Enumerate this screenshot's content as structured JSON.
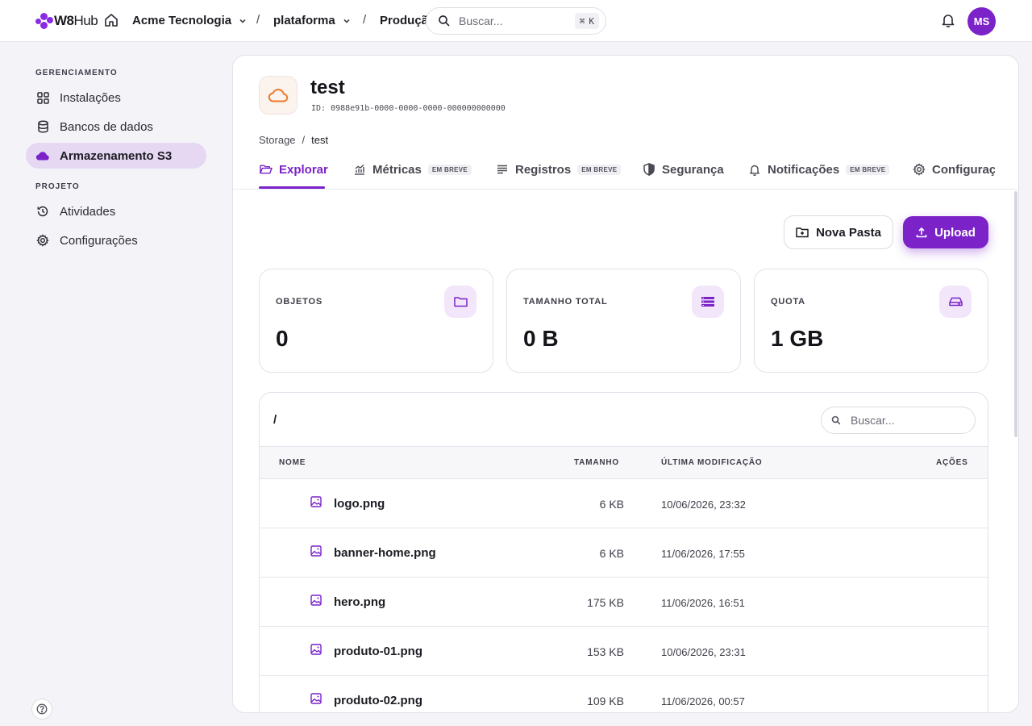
{
  "brand": {
    "name_bold": "W8",
    "name_light": "Hub",
    "accent": "#7b22c9"
  },
  "topbar": {
    "org": "Acme Tecnologia",
    "project": "plataforma",
    "environment": "Produção",
    "sep": "/",
    "search_placeholder": "Buscar...",
    "search_shortcut_key": "K",
    "avatar_initials": "MS"
  },
  "sidebar": {
    "section_manage": "GERENCIAMENTO",
    "section_project": "PROJETO",
    "items": [
      {
        "label": "Instalações",
        "icon": "grid-icon"
      },
      {
        "label": "Bancos de dados",
        "icon": "database-icon"
      },
      {
        "label": "Armazenamento S3",
        "icon": "cloud-icon",
        "active": true
      },
      {
        "label": "Atividades",
        "icon": "history-icon"
      },
      {
        "label": "Configurações",
        "icon": "gear-icon"
      }
    ]
  },
  "bucket": {
    "name": "test",
    "id_text": "ID: 0988e91b-0000-0000-0000-000000000000",
    "breadcrumb": [
      "Storage",
      "test"
    ],
    "breadcrumb_sep": "/"
  },
  "tabs": [
    {
      "label": "Explorar",
      "active": true
    },
    {
      "label": "Métricas",
      "badge": "EM BREVE"
    },
    {
      "label": "Registros",
      "badge": "EM BREVE"
    },
    {
      "label": "Segurança"
    },
    {
      "label": "Notificações",
      "badge": "EM BREVE"
    },
    {
      "label": "Configurações"
    }
  ],
  "actions": {
    "new_folder": "Nova Pasta",
    "upload": "Upload"
  },
  "stats": [
    {
      "label": "OBJETOS",
      "value": "0"
    },
    {
      "label": "TAMANHO TOTAL",
      "value": "0 B"
    },
    {
      "label": "QUOTA",
      "value": "1 GB"
    }
  ],
  "browser": {
    "path": "/",
    "search_placeholder": "Buscar...",
    "columns": {
      "name": "NOME",
      "size": "TAMANHO",
      "modified": "ÚLTIMA MODIFICAÇÃO",
      "actions": "AÇÕES"
    },
    "files": [
      {
        "name": "logo.png",
        "size": "6 KB",
        "modified": "10/06/2026, 23:32"
      },
      {
        "name": "banner-home.png",
        "size": "6 KB",
        "modified": "11/06/2026, 17:55"
      },
      {
        "name": "hero.png",
        "size": "175 KB",
        "modified": "11/06/2026, 16:51"
      },
      {
        "name": "produto-01.png",
        "size": "153 KB",
        "modified": "10/06/2026, 23:31"
      },
      {
        "name": "produto-02.png",
        "size": "109 KB",
        "modified": "11/06/2026, 00:57"
      }
    ]
  }
}
